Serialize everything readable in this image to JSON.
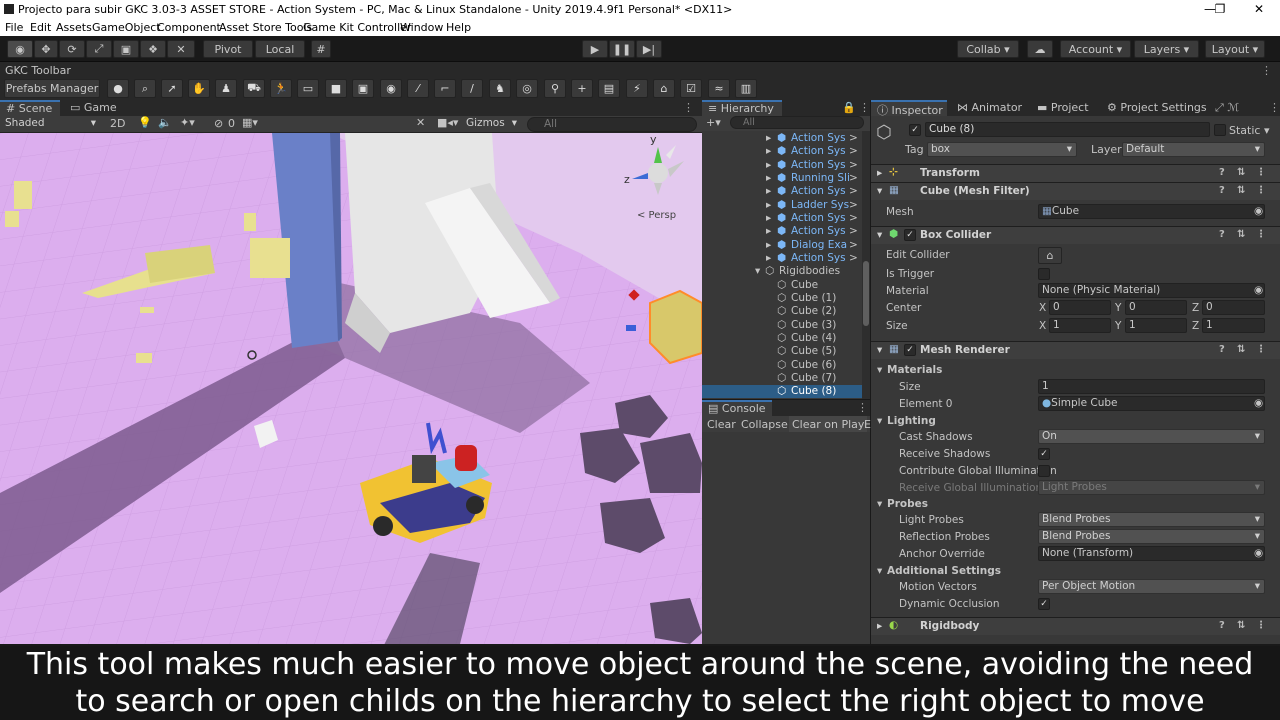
{
  "window": {
    "title": "Projecto para subir GKC 3.03-3 ASSET STORE - Action System - PC, Mac & Linux Standalone - Unity 2019.4.9f1 Personal* <DX11>",
    "controls": [
      "—",
      "❐",
      "✕"
    ]
  },
  "menu": [
    "File",
    "Edit",
    "Assets",
    "GameObject",
    "Component",
    "Asset Store Tools",
    "Game Kit Controller",
    "Window",
    "Help"
  ],
  "toolbar": {
    "pivot": "Pivot",
    "local": "Local",
    "collab": "Collab",
    "account": "Account",
    "layers": "Layers",
    "layout": "Layout"
  },
  "gkc": {
    "title": "GKC Toolbar",
    "prefabs_manager": "Prefabs Manager"
  },
  "scene": {
    "tab_scene": "Scene",
    "tab_game": "Game",
    "shading": "Shaded",
    "mode_2d": "2D",
    "fx_count": "0",
    "gizmos": "Gizmos",
    "search_placeholder": "All",
    "persp": "< Persp",
    "axis_y": "y",
    "axis_z": "z"
  },
  "hierarchy": {
    "tab": "Hierarchy",
    "search_placeholder": "All",
    "items": [
      {
        "label": "Action Sys",
        "prefab": true
      },
      {
        "label": "Action Sys",
        "prefab": true
      },
      {
        "label": "Action Sys",
        "prefab": true
      },
      {
        "label": "Running Sli",
        "prefab": true
      },
      {
        "label": "Action Sys",
        "prefab": true
      },
      {
        "label": "Ladder Sys",
        "prefab": true
      },
      {
        "label": "Action Sys",
        "prefab": true
      },
      {
        "label": "Action Sys",
        "prefab": true
      },
      {
        "label": "Dialog Exa",
        "prefab": true
      },
      {
        "label": "Action Sys",
        "prefab": true
      }
    ],
    "group": "Rigidbodies",
    "children": [
      "Cube",
      "Cube (1)",
      "Cube (2)",
      "Cube (3)",
      "Cube (4)",
      "Cube (5)",
      "Cube (6)",
      "Cube (7)",
      "Cube (8)"
    ]
  },
  "console": {
    "tab": "Console",
    "buttons": [
      "Clear",
      "Collapse",
      "Clear on Play",
      "E"
    ]
  },
  "inspector": {
    "tabs": [
      "Inspector",
      "Animator",
      "Project",
      "Project Settings"
    ],
    "object_name": "Cube (8)",
    "static": "Static",
    "tag_label": "Tag",
    "tag_value": "box",
    "layer_label": "Layer",
    "layer_value": "Default",
    "transform": "Transform",
    "mesh_filter": "Cube (Mesh Filter)",
    "mesh_label": "Mesh",
    "mesh_value": "Cube",
    "box_collider": "Box Collider",
    "edit_collider": "Edit Collider",
    "is_trigger": "Is Trigger",
    "material_label": "Material",
    "material_value": "None (Physic Material)",
    "center_label": "Center",
    "center": {
      "x": "0",
      "y": "0",
      "z": "0"
    },
    "size_label": "Size",
    "size": {
      "x": "1",
      "y": "1",
      "z": "1"
    },
    "mesh_renderer": "Mesh Renderer",
    "materials": "Materials",
    "mat_size_label": "Size",
    "mat_size_value": "1",
    "element0_label": "Element 0",
    "element0_value": "Simple Cube",
    "lighting": "Lighting",
    "cast_shadows": "Cast Shadows",
    "cast_shadows_value": "On",
    "receive_shadows": "Receive Shadows",
    "contribute_gi": "Contribute Global Illumination",
    "receive_gi": "Receive Global Illumination",
    "receive_gi_value": "Light Probes",
    "probes": "Probes",
    "light_probes": "Light Probes",
    "light_probes_value": "Blend Probes",
    "reflection_probes": "Reflection Probes",
    "reflection_probes_value": "Blend Probes",
    "anchor_override": "Anchor Override",
    "anchor_override_value": "None (Transform)",
    "additional_settings": "Additional Settings",
    "motion_vectors": "Motion Vectors",
    "motion_vectors_value": "Per Object Motion",
    "dynamic_occlusion": "Dynamic Occlusion",
    "rigidbody": "Rigidbody"
  },
  "subtitle": {
    "line1": "This tool makes much easier to move object around the scene, avoiding the need",
    "line2": "to search or open childs on the hierarchy to select the right object to move"
  }
}
